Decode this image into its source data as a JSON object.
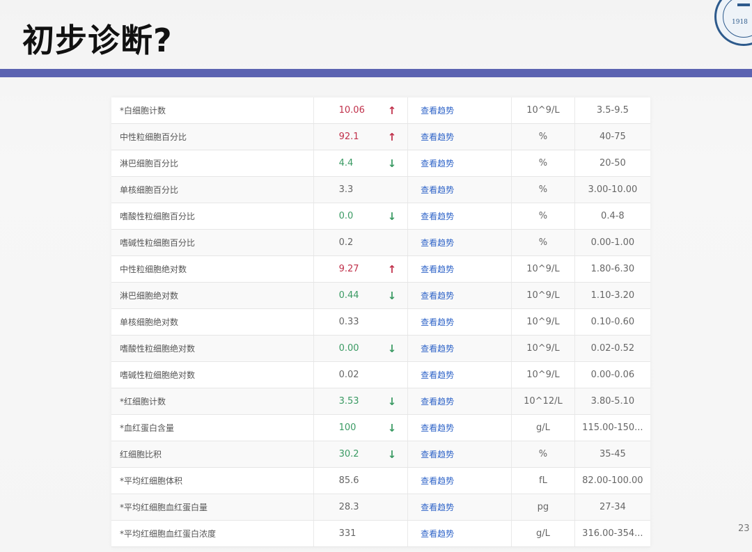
{
  "slide": {
    "title": "初步诊断?",
    "page_number": "23",
    "logo_year": "1918",
    "accent_color": "#5b63b1"
  },
  "table": {
    "trend_label": "查看趋势",
    "colors": {
      "high": "#c0304a",
      "low": "#3a9a63",
      "link": "#2f64c8"
    },
    "rows": [
      {
        "name": "*白细胞计数",
        "value": "10.06",
        "flag": "↑",
        "status": "high",
        "unit": "10^9/L",
        "range": "3.5-9.5"
      },
      {
        "name": "中性粒细胞百分比",
        "value": "92.1",
        "flag": "↑",
        "status": "high",
        "unit": "%",
        "range": "40-75"
      },
      {
        "name": "淋巴细胞百分比",
        "value": "4.4",
        "flag": "↓",
        "status": "low",
        "unit": "%",
        "range": "20-50"
      },
      {
        "name": "单核细胞百分比",
        "value": "3.3",
        "flag": "",
        "status": "normal",
        "unit": "%",
        "range": "3.00-10.00"
      },
      {
        "name": "嗜酸性粒细胞百分比",
        "value": "0.0",
        "flag": "↓",
        "status": "low",
        "unit": "%",
        "range": "0.4-8"
      },
      {
        "name": "嗜碱性粒细胞百分比",
        "value": "0.2",
        "flag": "",
        "status": "normal",
        "unit": "%",
        "range": "0.00-1.00"
      },
      {
        "name": "中性粒细胞绝对数",
        "value": "9.27",
        "flag": "↑",
        "status": "high",
        "unit": "10^9/L",
        "range": "1.80-6.30"
      },
      {
        "name": "淋巴细胞绝对数",
        "value": "0.44",
        "flag": "↓",
        "status": "low",
        "unit": "10^9/L",
        "range": "1.10-3.20"
      },
      {
        "name": "单核细胞绝对数",
        "value": "0.33",
        "flag": "",
        "status": "normal",
        "unit": "10^9/L",
        "range": "0.10-0.60"
      },
      {
        "name": "嗜酸性粒细胞绝对数",
        "value": "0.00",
        "flag": "↓",
        "status": "low",
        "unit": "10^9/L",
        "range": "0.02-0.52"
      },
      {
        "name": "嗜碱性粒细胞绝对数",
        "value": "0.02",
        "flag": "",
        "status": "normal",
        "unit": "10^9/L",
        "range": "0.00-0.06"
      },
      {
        "name": "*红细胞计数",
        "value": "3.53",
        "flag": "↓",
        "status": "low",
        "unit": "10^12/L",
        "range": "3.80-5.10"
      },
      {
        "name": "*血红蛋白含量",
        "value": "100",
        "flag": "↓",
        "status": "low",
        "unit": "g/L",
        "range": "115.00-150..."
      },
      {
        "name": "红细胞比积",
        "value": "30.2",
        "flag": "↓",
        "status": "low",
        "unit": "%",
        "range": "35-45"
      },
      {
        "name": "*平均红细胞体积",
        "value": "85.6",
        "flag": "",
        "status": "normal",
        "unit": "fL",
        "range": "82.00-100.00"
      },
      {
        "name": "*平均红细胞血红蛋白量",
        "value": "28.3",
        "flag": "",
        "status": "normal",
        "unit": "pg",
        "range": "27-34"
      },
      {
        "name": "*平均红细胞血红蛋白浓度",
        "value": "331",
        "flag": "",
        "status": "normal",
        "unit": "g/L",
        "range": "316.00-354..."
      }
    ]
  }
}
